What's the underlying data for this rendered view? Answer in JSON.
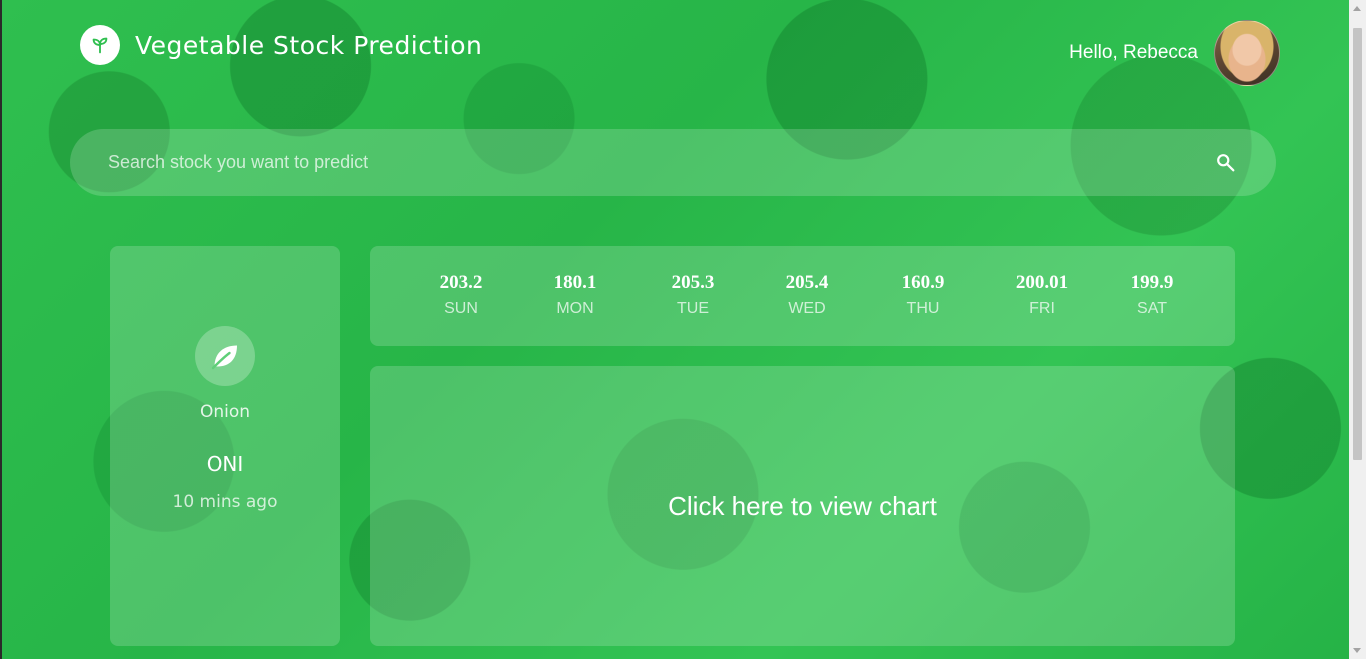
{
  "header": {
    "title": "Vegetable Stock Prediction",
    "logo_icon": "sprout-icon",
    "greeting": "Hello, Rebecca"
  },
  "search": {
    "placeholder": "Search stock you want to predict",
    "value": "",
    "icon": "search-icon"
  },
  "stock": {
    "icon": "leaf-icon",
    "name": "Onion",
    "code": "ONI",
    "updated": "10 mins ago"
  },
  "week": [
    {
      "value": "203.2",
      "day": "SUN"
    },
    {
      "value": "180.1",
      "day": "MON"
    },
    {
      "value": "205.3",
      "day": "TUE"
    },
    {
      "value": "205.4",
      "day": "WED"
    },
    {
      "value": "160.9",
      "day": "THU"
    },
    {
      "value": "200.01",
      "day": "FRI"
    },
    {
      "value": "199.9",
      "day": "SAT"
    }
  ],
  "chart_panel": {
    "link_label": "Click here to view chart"
  },
  "colors": {
    "background": "#2fbf4f",
    "text": "#ffffff"
  }
}
